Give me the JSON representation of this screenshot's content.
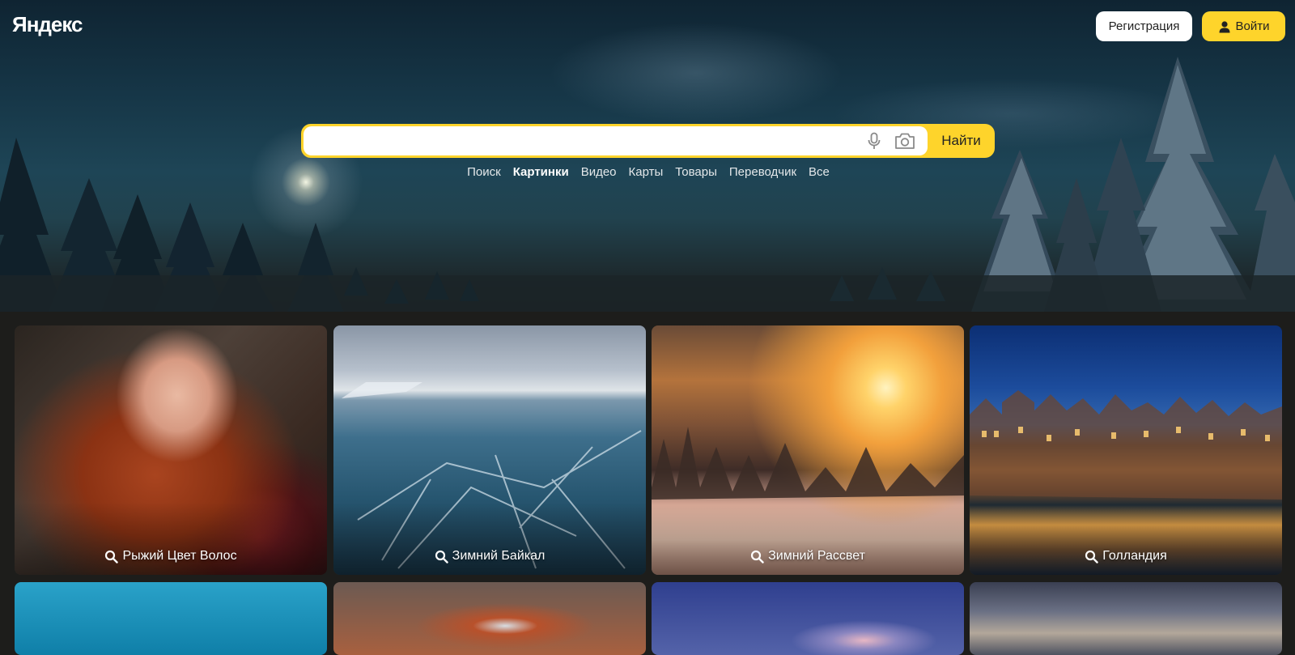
{
  "header": {
    "logo": "Яндекс",
    "register_label": "Регистрация",
    "login_label": "Войти",
    "login_icon": "user-icon"
  },
  "search": {
    "value": "",
    "placeholder": "",
    "submit_label": "Найти",
    "icons": [
      "microphone-icon",
      "camera-icon"
    ]
  },
  "nav": {
    "items": [
      {
        "label": "Поиск",
        "active": false
      },
      {
        "label": "Картинки",
        "active": true
      },
      {
        "label": "Видео",
        "active": false
      },
      {
        "label": "Карты",
        "active": false
      },
      {
        "label": "Товары",
        "active": false
      },
      {
        "label": "Переводчик",
        "active": false
      },
      {
        "label": "Все",
        "active": false
      }
    ]
  },
  "gallery": {
    "tiles": [
      {
        "caption": "Рыжий Цвет Волос"
      },
      {
        "caption": "Зимний Байкал"
      },
      {
        "caption": "Зимний Рассвет"
      },
      {
        "caption": "Голландия"
      }
    ]
  },
  "colors": {
    "accent": "#fed42b",
    "page_background": "#1d1d1b"
  }
}
